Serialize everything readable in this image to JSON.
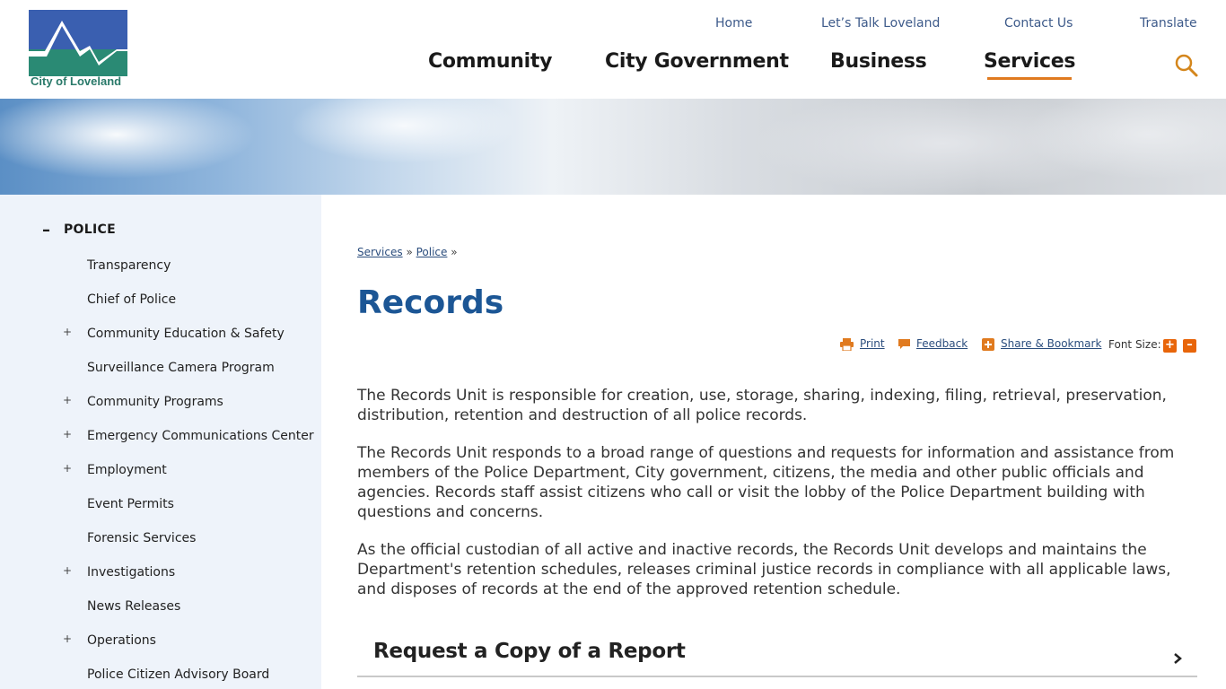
{
  "logo": {
    "text": "City of Loveland"
  },
  "utility_nav": [
    "Home",
    "Let’s Talk Loveland",
    "Contact Us",
    "Translate"
  ],
  "main_nav": [
    "Community",
    "City Government",
    "Business",
    "Services"
  ],
  "main_nav_active": "Services",
  "sidebar": {
    "section": "POLICE",
    "items": [
      {
        "label": "Transparency",
        "expandable": false
      },
      {
        "label": "Chief of Police",
        "expandable": false
      },
      {
        "label": "Community Education & Safety",
        "expandable": true
      },
      {
        "label": "Surveillance Camera Program",
        "expandable": false
      },
      {
        "label": "Community Programs",
        "expandable": true
      },
      {
        "label": "Emergency Communications Center",
        "expandable": true
      },
      {
        "label": "Employment",
        "expandable": true
      },
      {
        "label": "Event Permits",
        "expandable": false
      },
      {
        "label": "Forensic Services",
        "expandable": false
      },
      {
        "label": "Investigations",
        "expandable": true
      },
      {
        "label": "News Releases",
        "expandable": false
      },
      {
        "label": "Operations",
        "expandable": true
      },
      {
        "label": "Police Citizen Advisory Board",
        "expandable": false
      }
    ]
  },
  "breadcrumb": {
    "items": [
      "Services",
      "Police"
    ],
    "separator": "»"
  },
  "page_title": "Records",
  "tools": {
    "print": "Print",
    "feedback": "Feedback",
    "share": "Share & Bookmark",
    "font_size": "Font Size:"
  },
  "paragraphs": [
    "The Records Unit is responsible for creation, use, storage, sharing, indexing, filing, retrieval, preservation, distribution, retention and destruction of all police records.",
    "The Records Unit responds to a broad range of questions and requests for information and assistance from members of the Police Department, City government, citizens, the media and other public officials and agencies. Records staff assist citizens who call or visit the lobby of the Police Department building with questions and concerns.",
    "As the official custodian of all active and inactive records, the Records Unit develops and maintains the Department's retention schedules, releases criminal justice records in compliance with all applicable laws, and disposes of records at the end of the approved retention schedule."
  ],
  "accordion": {
    "title": "Request a Copy of a Report"
  },
  "colors": {
    "brand_blue": "#1c5695",
    "accent_orange": "#e07a1f",
    "sidebar_bg": "#eef3fa",
    "logo_blue": "#3a5fb0",
    "logo_green": "#2a8a74"
  },
  "icons": [
    "search-icon",
    "print-icon",
    "feedback-icon",
    "share-icon",
    "font-increase-icon",
    "font-decrease-icon",
    "chevron-right-icon",
    "collapse-icon",
    "expand-icon"
  ]
}
